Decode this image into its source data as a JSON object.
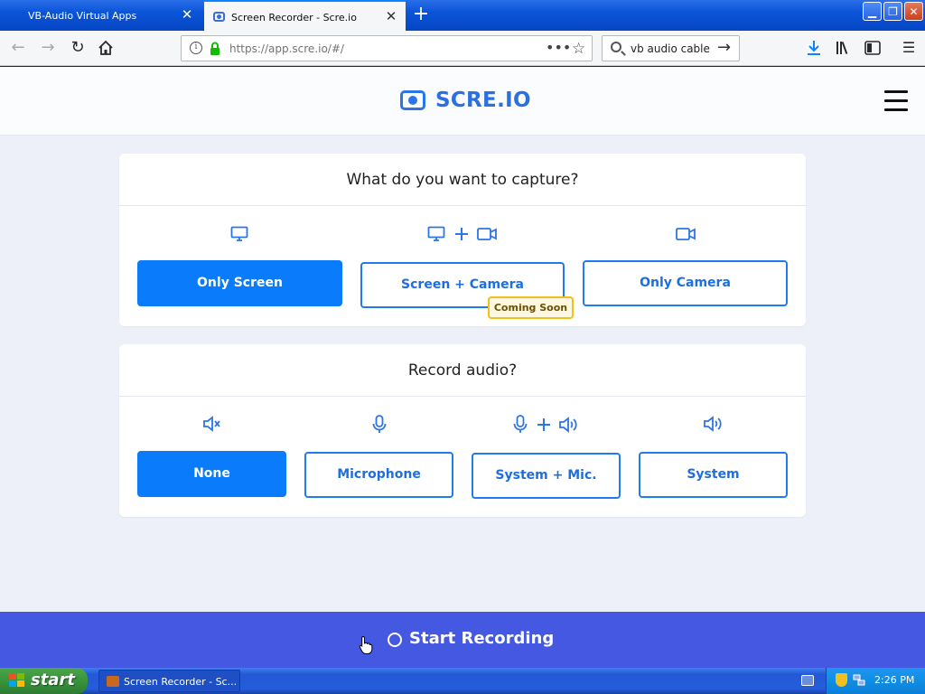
{
  "browser": {
    "tabs": [
      {
        "title": "VB-Audio Virtual Apps",
        "active": false
      },
      {
        "title": "Screen Recorder - Scre.io",
        "active": true
      }
    ],
    "url": "https://app.scre.io/#/",
    "search_query": "vb audio cable",
    "icons": [
      "back-icon",
      "forward-icon",
      "reload-icon",
      "home-icon",
      "info-icon",
      "lock-icon",
      "page-actions-icon",
      "bookmark-star-icon",
      "search-icon",
      "download-icon",
      "library-icon",
      "sidebar-icon",
      "menu-icon"
    ]
  },
  "site": {
    "logo_text": "SCRE.IO",
    "brand_color": "#2c75e8"
  },
  "capture": {
    "title": "What do you want to capture?",
    "options": [
      {
        "label": "Only Screen",
        "icon": "monitor-icon",
        "selected": true
      },
      {
        "label": "Screen + Camera",
        "icon": "monitor-plus-camera-icon",
        "selected": false,
        "badge": "Coming Soon"
      },
      {
        "label": "Only Camera",
        "icon": "video-camera-icon",
        "selected": false
      }
    ]
  },
  "audio": {
    "title": "Record audio?",
    "options": [
      {
        "label": "None",
        "icon": "speaker-mute-icon",
        "selected": true
      },
      {
        "label": "Microphone",
        "icon": "microphone-icon",
        "selected": false
      },
      {
        "label": "System + Mic.",
        "icon": "mic-plus-speaker-icon",
        "selected": false
      },
      {
        "label": "System",
        "icon": "speaker-icon",
        "selected": false
      }
    ]
  },
  "record": {
    "label": "Start Recording",
    "bar_color": "#4458e2"
  },
  "taskbar": {
    "start_label": "start",
    "task_label": "Screen Recorder - Sc...",
    "clock": "2:26 PM"
  }
}
